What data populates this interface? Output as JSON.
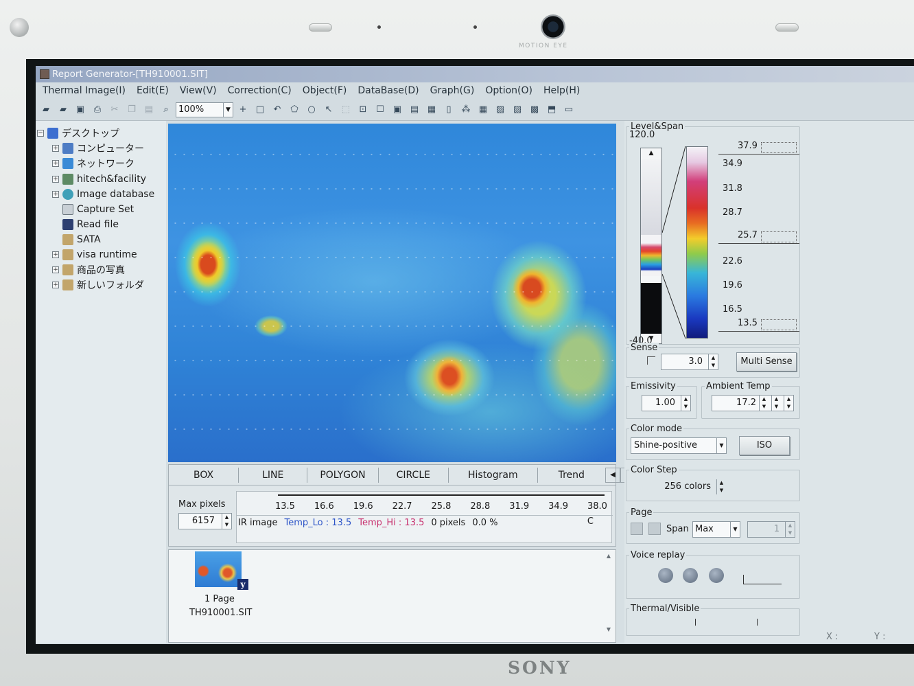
{
  "bezel": {
    "camera_label": "MOTION EYE",
    "brand": "SONY"
  },
  "window": {
    "title": "Report Generator-[TH910001.SIT]"
  },
  "menu": [
    "Thermal Image(I)",
    "Edit(E)",
    "View(V)",
    "Correction(C)",
    "Object(F)",
    "DataBase(D)",
    "Graph(G)",
    "Option(O)",
    "Help(H)"
  ],
  "toolbar": {
    "zoom": "100%"
  },
  "tree": {
    "root": "デスクトップ",
    "items": [
      "コンピューター",
      "ネットワーク",
      "hitech&facility",
      "Image database",
      "Capture Set",
      "Read file",
      "SATA",
      "visa runtime",
      "商品の写真",
      "新しいフォルダ"
    ]
  },
  "object_tabs": [
    "BOX",
    "LINE",
    "POLYGON",
    "CIRCLE",
    "Histogram",
    "Trend"
  ],
  "histogram": {
    "max_pixels_label": "Max pixels",
    "max_pixels": "6157",
    "ticks": [
      "13.5",
      "16.6",
      "19.6",
      "22.7",
      "25.8",
      "28.8",
      "31.9",
      "34.9",
      "38.0"
    ],
    "source": "IR image",
    "temp_lo_label": "Temp_Lo :",
    "temp_lo": "13.5",
    "temp_hi_label": "Temp_Hi :",
    "temp_hi": "13.5",
    "pixels": "0 pixels",
    "percent": "0.0 %",
    "unit": "C"
  },
  "thumbnail": {
    "badge": "y",
    "page": "1 Page",
    "file": "TH910001.SIT"
  },
  "level_span": {
    "title": "Level&Span",
    "max": "120.0",
    "min": "-40.0",
    "top_value": "37.9",
    "level_value": "25.7",
    "bottom_value": "13.5",
    "scale": [
      "34.9",
      "31.8",
      "28.7",
      "22.6",
      "19.6",
      "16.5"
    ]
  },
  "sense": {
    "title": "Sense",
    "value": "3.0",
    "button": "Multi Sense"
  },
  "emissivity": {
    "title": "Emissivity",
    "value": "1.00"
  },
  "ambient": {
    "title": "Ambient Temp",
    "value": "17.2"
  },
  "color_mode": {
    "title": "Color mode",
    "value": "Shine-positive",
    "button": "ISO"
  },
  "color_step": {
    "title": "Color Step",
    "value": "256 colors"
  },
  "page": {
    "title": "Page",
    "span_label": "Span",
    "span_value": "Max",
    "page_value": "1"
  },
  "voice": {
    "title": "Voice replay"
  },
  "thermal_visible": {
    "title": "Thermal/Visible"
  },
  "status": {
    "x": "X :",
    "y": "Y :"
  }
}
